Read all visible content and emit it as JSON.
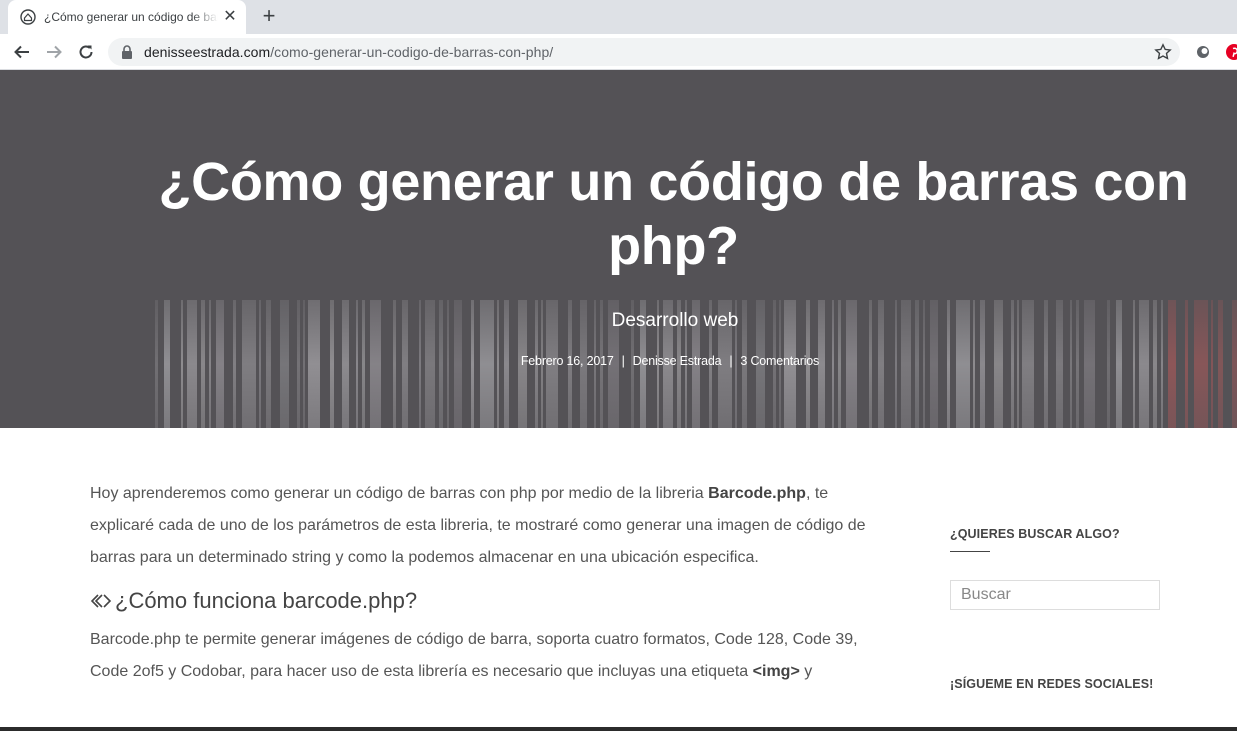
{
  "browser": {
    "tab_title": "¿Cómo generar un código de barras con php?",
    "url_host": "denisseestrada.com",
    "url_path": "/como-generar-un-codigo-de-barras-con-php/"
  },
  "hero": {
    "title": "¿Cómo generar un código de barras con php?",
    "category": "Desarrollo web",
    "date": "Febrero 16, 2017",
    "author": "Denisse Estrada",
    "comments": "3 Comentarios",
    "separator": "|"
  },
  "article": {
    "intro_before": "Hoy aprenderemos como generar un código de barras con php por medio de la libreria ",
    "intro_bold": "Barcode.php",
    "intro_after": ",  te explicaré cada de uno de los parámetros de esta libreria, te mostraré como generar una imagen de código de barras para un determinado string y como la podemos almacenar en una ubicación especifica.",
    "heading": "¿Cómo funciona barcode.php?",
    "p2_before": "Barcode.php te permite generar imágenes de código de barra, soporta cuatro formatos, Code 128, Code 39, Code 2of5 y Codobar, para hacer uso de esta librería es necesario que incluyas una etiqueta ",
    "p2_bold": "<img>",
    "p2_after": " y"
  },
  "sidebar": {
    "search_title": "¿QUIERES BUSCAR ALGO?",
    "search_placeholder": "Buscar",
    "social_title": "¡SÍGUEME EN REDES SOCIALES!"
  },
  "colors": {
    "hero_bg": "#545256",
    "bar_light": "#a8a6aa",
    "bar_red": "#b85a5a"
  }
}
